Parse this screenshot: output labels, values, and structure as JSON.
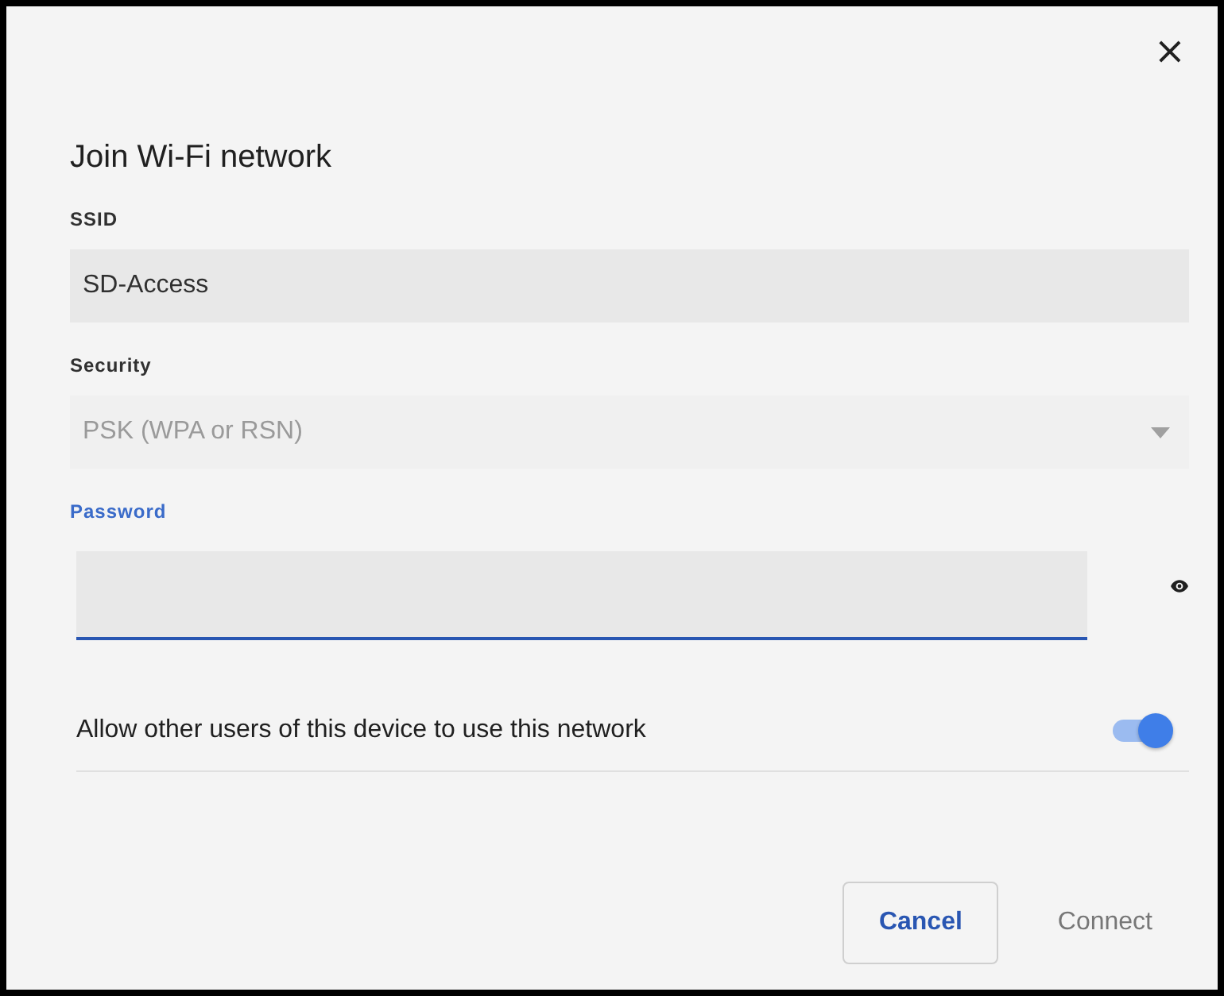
{
  "dialog": {
    "title": "Join Wi-Fi network",
    "close": "×"
  },
  "fields": [
    {
      "kind": "text",
      "label": "SSID",
      "value": "SD-Access",
      "focused": false,
      "disabled": false
    },
    {
      "kind": "dropdown",
      "label": "Security",
      "value": "PSK (WPA or RSN)",
      "focused": false,
      "disabled": true
    },
    {
      "kind": "password",
      "label": "Password",
      "focused": true,
      "disabled": false
    }
  ],
  "share": {
    "label": "Allow other users of this device to use this network",
    "on": true
  },
  "buttons": [
    {
      "label": "Cancel",
      "primary": true,
      "disabled": false
    },
    {
      "label": "Connect",
      "primary": false,
      "disabled": true
    }
  ]
}
